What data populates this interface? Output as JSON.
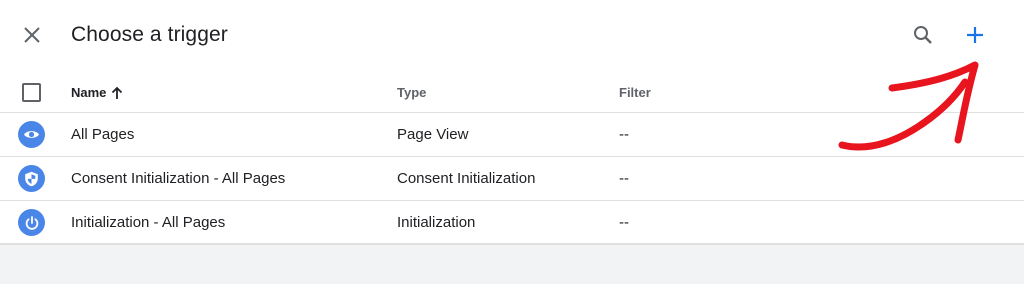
{
  "header": {
    "title": "Choose a trigger",
    "close_icon": "close-icon",
    "search_icon": "search-icon",
    "add_icon": "plus-icon",
    "accent_color": "#1a73e8"
  },
  "table": {
    "columns": {
      "name": "Name",
      "type": "Type",
      "filter": "Filter"
    },
    "sort_icon": "arrow-up-icon",
    "rows": [
      {
        "icon": "eye-icon",
        "name": "All Pages",
        "type": "Page View",
        "filter": "--"
      },
      {
        "icon": "shield-icon",
        "name": "Consent Initialization - All Pages",
        "type": "Consent Initialization",
        "filter": "--"
      },
      {
        "icon": "power-icon",
        "name": "Initialization - All Pages",
        "type": "Initialization",
        "filter": "--"
      }
    ]
  },
  "annotation": {
    "icon": "red-arrow-annotation",
    "color": "#e8141e"
  }
}
